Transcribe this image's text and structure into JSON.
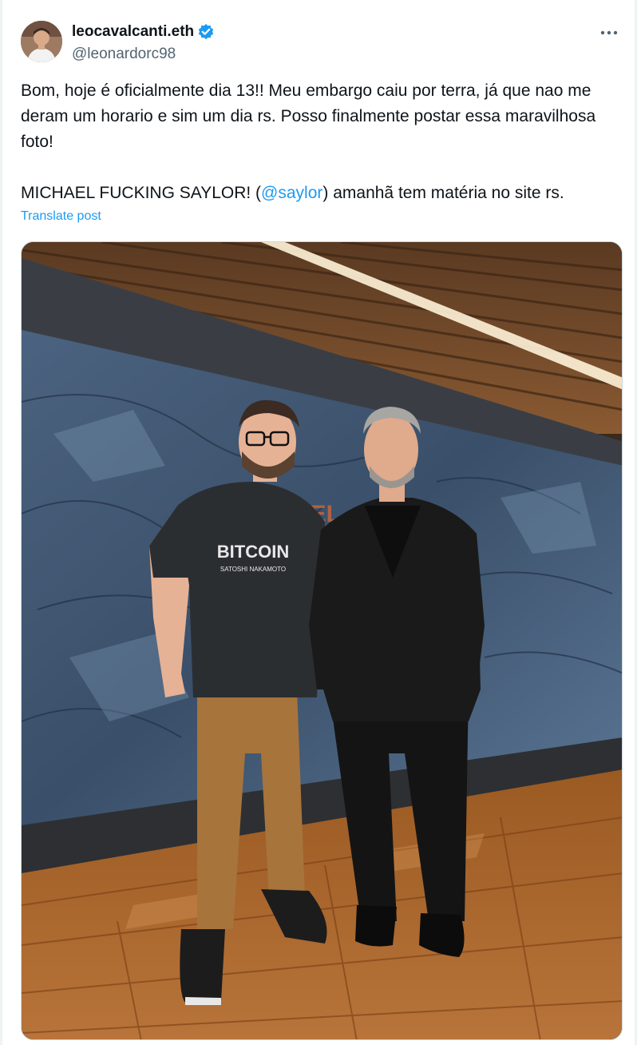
{
  "author": {
    "display_name": "leocavalcanti.eth",
    "handle": "@leonardorc98",
    "verified": true,
    "avatar_icon": "person-avatar"
  },
  "post": {
    "paragraph1": "Bom, hoje é oficialmente dia 13!! Meu embargo caiu por terra, já que nao me deram um horario e sim um dia rs. Posso finalmente postar essa maravilhosa foto!",
    "paragraph2_before": "MICHAEL FUCKING SAYLOR!  (",
    "mention": "@saylor",
    "paragraph2_after": ") amanhã tem matéria no site rs.",
    "translate_label": "Translate post"
  },
  "media": {
    "shirt_text": "BITCOIN",
    "shirt_subtext": "SATOSHI NAKAMOTO",
    "wall_sign": "AEL"
  },
  "colors": {
    "accent": "#1d9bf0",
    "text": "#0f1419",
    "secondary": "#536471"
  }
}
